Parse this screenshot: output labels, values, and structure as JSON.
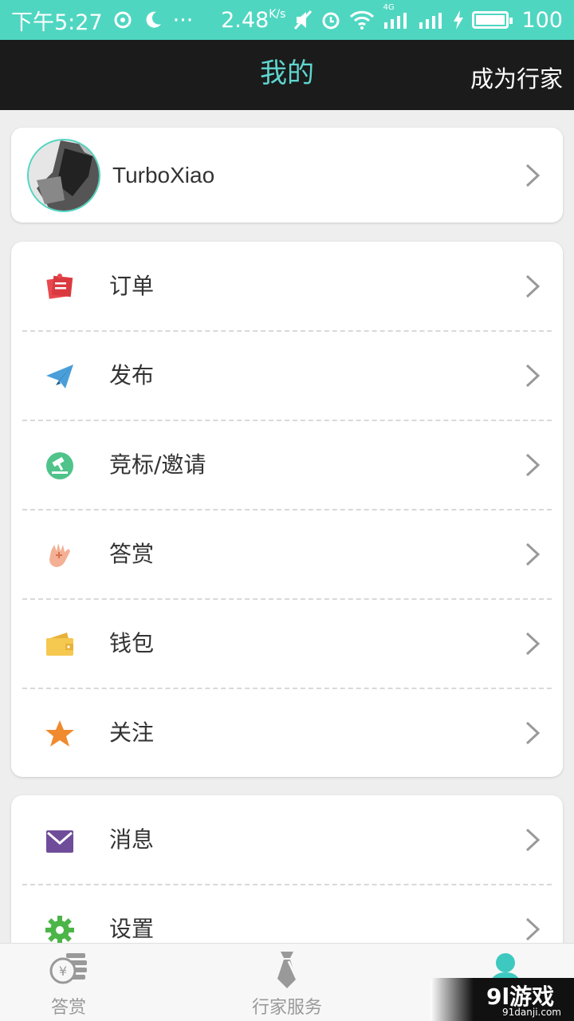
{
  "status_bar": {
    "time": "下午5:27",
    "more": "···",
    "speed": "2.48",
    "speed_unit": "K/s",
    "network": "4G",
    "battery": "100"
  },
  "header": {
    "title": "我的",
    "action": "成为行家"
  },
  "profile": {
    "username": "TurboXiao"
  },
  "menu_group_1": [
    {
      "label": "订单",
      "icon": "order-icon",
      "color": "#e8494f"
    },
    {
      "label": "发布",
      "icon": "paper-plane-icon",
      "color": "#4a9fd8"
    },
    {
      "label": "竞标/邀请",
      "icon": "gavel-icon",
      "color": "#4fc38a"
    },
    {
      "label": "答赏",
      "icon": "hand-icon",
      "color": "#f0a080"
    },
    {
      "label": "钱包",
      "icon": "wallet-icon",
      "color": "#f5c850"
    },
    {
      "label": "关注",
      "icon": "star-icon",
      "color": "#f08a2e"
    }
  ],
  "menu_group_2": [
    {
      "label": "消息",
      "icon": "mail-icon",
      "color": "#6f4d9a"
    },
    {
      "label": "设置",
      "icon": "gear-icon",
      "color": "#4cb548"
    }
  ],
  "tabs": [
    {
      "label": "答赏",
      "icon": "coins-icon"
    },
    {
      "label": "行家服务",
      "icon": "tie-icon"
    },
    {
      "label": "",
      "icon": "user-icon",
      "active": true
    }
  ],
  "watermark": {
    "main": "9l游戏",
    "sub": "91danji.com"
  },
  "colors": {
    "accent": "#4fd6c1",
    "header_bg": "#1b1b1b"
  }
}
